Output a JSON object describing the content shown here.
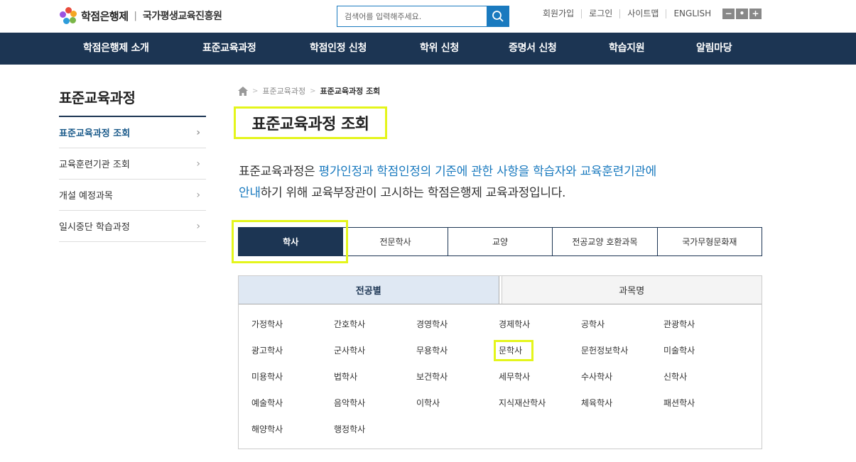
{
  "header": {
    "logo_title": "학점은행제",
    "logo_org": "국가평생교육진흥원",
    "search_placeholder": "검색어를 입력해주세요.",
    "util_links": [
      "회원가입",
      "로그인",
      "사이트맵",
      "ENGLISH"
    ],
    "zoom_buttons": [
      "−",
      "•",
      "+"
    ]
  },
  "nav": {
    "items": [
      "학점은행제 소개",
      "표준교육과정",
      "학점인정 신청",
      "학위 신청",
      "증명서 신청",
      "학습지원",
      "알림마당"
    ]
  },
  "sidebar": {
    "title": "표준교육과정",
    "items": [
      {
        "label": "표준교육과정 조회",
        "active": true
      },
      {
        "label": "교육훈련기관 조회",
        "active": false
      },
      {
        "label": "개설 예정과목",
        "active": false
      },
      {
        "label": "일시중단 학습과정",
        "active": false
      }
    ]
  },
  "breadcrumb": {
    "parent": "표준교육과정",
    "current": "표준교육과정 조회"
  },
  "page": {
    "title": "표준교육과정 조회",
    "intro_1": "표준교육과정은 ",
    "intro_2": "평가인정과 학점인정의 기준에 관한 사항을 학습자와 교육훈련기관에",
    "intro_3": "안내",
    "intro_4": "하기 위해 교육부장관이 고시하는 학점은행제 교육과정입니다."
  },
  "tabs": [
    "학사",
    "전문학사",
    "교양",
    "전공교양 호환과목",
    "국가무형문화재"
  ],
  "subtabs": [
    "전공별",
    "과목명"
  ],
  "majors": [
    "가정학사",
    "간호학사",
    "경영학사",
    "경제학사",
    "공학사",
    "관광학사",
    "광고학사",
    "군사학사",
    "무용학사",
    "문학사",
    "문헌정보학사",
    "미술학사",
    "미용학사",
    "법학사",
    "보건학사",
    "세무학사",
    "수사학사",
    "신학사",
    "예술학사",
    "음악학사",
    "이학사",
    "지식재산학사",
    "체육학사",
    "패션학사",
    "해양학사",
    "행정학사"
  ],
  "colors": {
    "navy": "#1c3553",
    "accent": "#1a7abf",
    "highlight": "#e4f51b"
  }
}
